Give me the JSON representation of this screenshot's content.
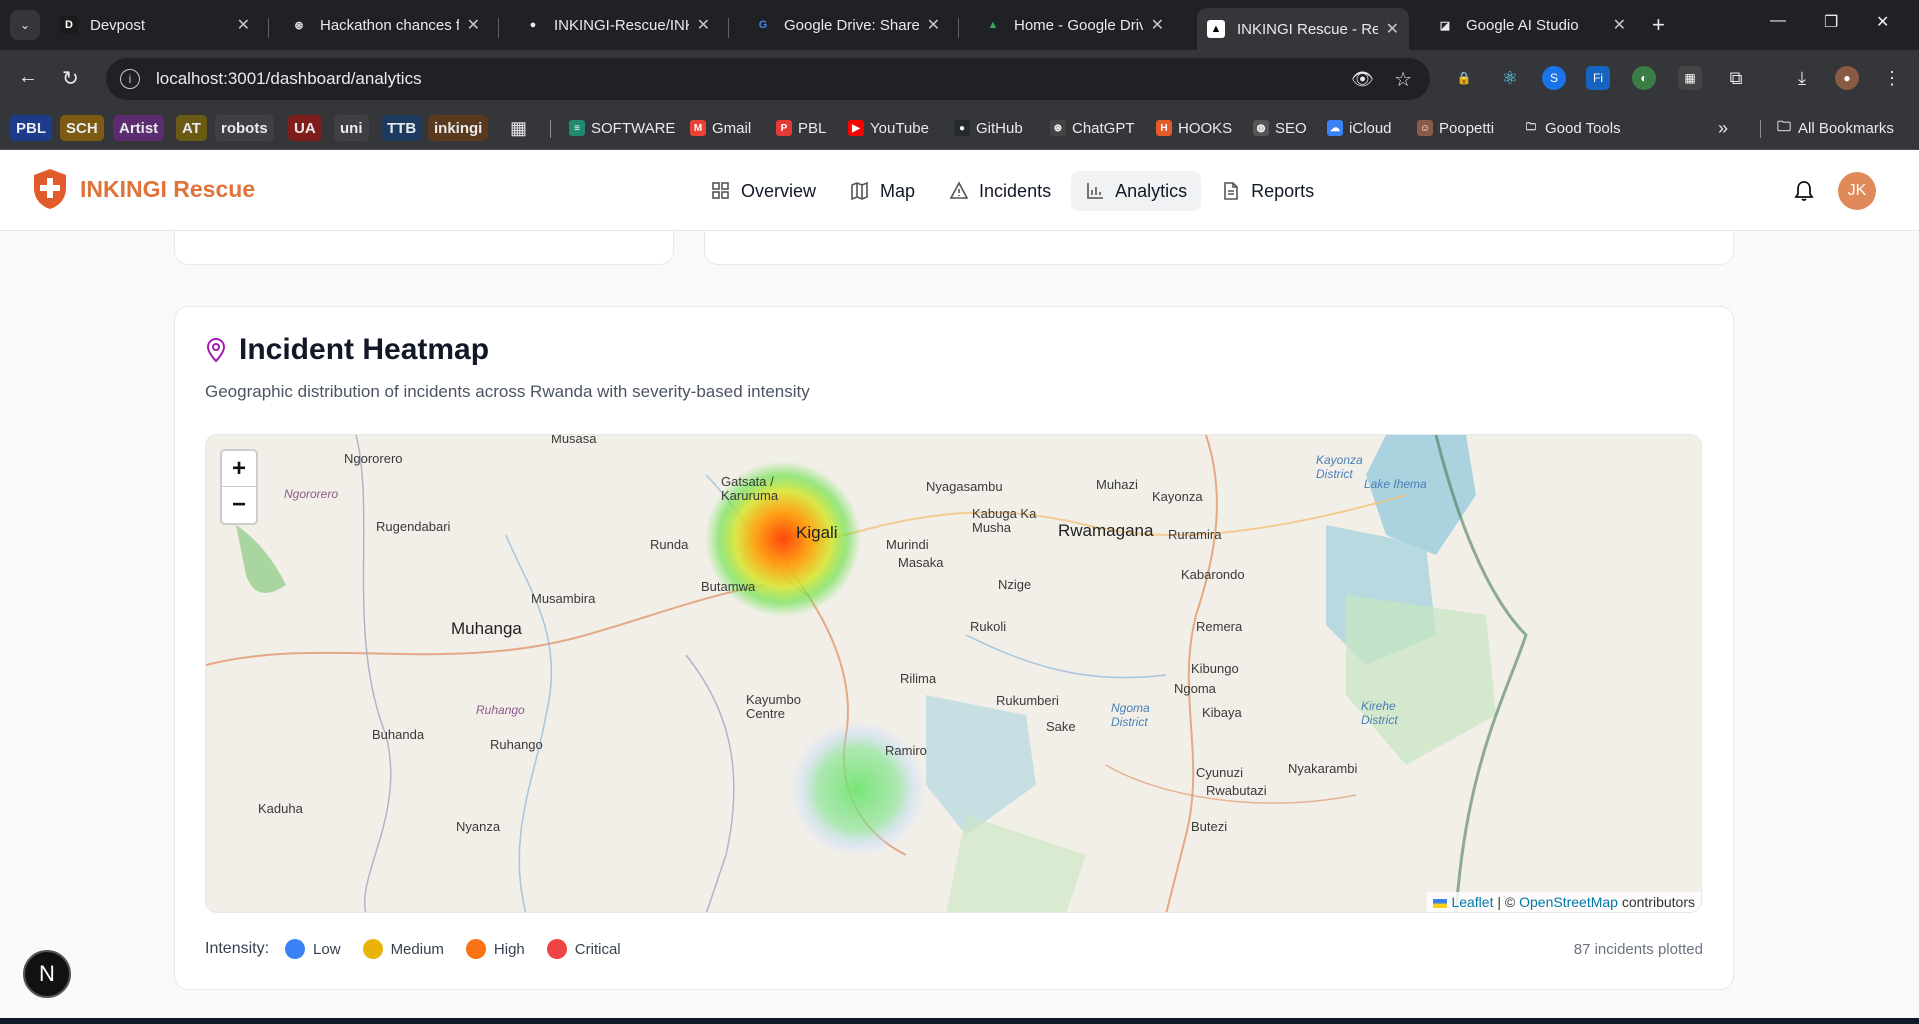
{
  "browser": {
    "tabs": [
      {
        "title": "Devpost",
        "icon": "devpost-icon"
      },
      {
        "title": "Hackathon chances fo",
        "icon": "chatgpt-icon"
      },
      {
        "title": "INKINGI-Rescue/INKI",
        "icon": "github-icon"
      },
      {
        "title": "Google Drive: Share l",
        "icon": "google-icon"
      },
      {
        "title": "Home - Google Drive",
        "icon": "google-drive-icon"
      },
      {
        "title": "INKINGI Rescue - Res",
        "icon": "vercel-icon",
        "active": true
      },
      {
        "title": "Google AI Studio",
        "icon": "ai-studio-icon"
      }
    ],
    "url": "localhost:3001/dashboard/analytics",
    "bookmarks_chips": [
      {
        "label": "PBL",
        "color": "#1e3a8a"
      },
      {
        "label": "SCH",
        "color": "#7c5a12"
      },
      {
        "label": "Artist",
        "color": "#5b2c6f"
      },
      {
        "label": "AT",
        "color": "#6b5a14"
      },
      {
        "label": "robots",
        "color": "#3f3f46"
      },
      {
        "label": "UA",
        "color": "#7f1d1d"
      },
      {
        "label": "uni",
        "color": "#3f3f46"
      },
      {
        "label": "TTB",
        "color": "#1e3a5f"
      },
      {
        "label": "inkingi",
        "color": "#5a3a1e"
      }
    ],
    "bookmarks": [
      {
        "label": "SOFTWARE",
        "icon": "software-icon"
      },
      {
        "label": "Gmail",
        "icon": "gmail-icon"
      },
      {
        "label": "PBL",
        "icon": "pbl-icon"
      },
      {
        "label": "YouTube",
        "icon": "youtube-icon"
      },
      {
        "label": "GitHub",
        "icon": "github-icon"
      },
      {
        "label": "ChatGPT",
        "icon": "chatgpt-icon"
      },
      {
        "label": "HOOKS",
        "icon": "hooks-icon"
      },
      {
        "label": "SEO",
        "icon": "globe-icon"
      },
      {
        "label": "iCloud",
        "icon": "icloud-icon"
      },
      {
        "label": "Poopetti",
        "icon": "poopetti-icon"
      },
      {
        "label": "Good Tools",
        "icon": "folder-icon"
      }
    ],
    "all_bookmarks": "All Bookmarks"
  },
  "app": {
    "brand": "INKINGI Rescue",
    "nav": [
      {
        "label": "Overview",
        "icon": "grid-icon"
      },
      {
        "label": "Map",
        "icon": "map-icon"
      },
      {
        "label": "Incidents",
        "icon": "warning-icon"
      },
      {
        "label": "Analytics",
        "icon": "bar-chart-icon",
        "active": true
      },
      {
        "label": "Reports",
        "icon": "document-icon"
      }
    ],
    "avatar_initials": "JK"
  },
  "heatmap": {
    "title": "Incident Heatmap",
    "subtitle": "Geographic distribution of incidents across Rwanda with severity-based intensity",
    "zoom_in": "+",
    "zoom_out": "−",
    "attribution": {
      "leaflet": "Leaflet",
      "sep": "| ©",
      "osm": "OpenStreetMap",
      "suffix": "contributors"
    },
    "legend_label": "Intensity:",
    "legend": [
      {
        "label": "Low",
        "color": "#3b82f6"
      },
      {
        "label": "Medium",
        "color": "#eab308"
      },
      {
        "label": "High",
        "color": "#f97316"
      },
      {
        "label": "Critical",
        "color": "#ef4444"
      }
    ],
    "plotted": "87 incidents plotted",
    "places": [
      "Musasa",
      "Ngororero",
      "Ngororero",
      "Rugendabari",
      "Gatsata / Karuruma",
      "Kigali",
      "Nyagasambu",
      "Muhazi",
      "Kayonza District",
      "Kayonza",
      "Lake Ihema",
      "Kabuga Ka Musha",
      "Rwamagana",
      "Ruramira",
      "Runda",
      "Murindi",
      "Masaka",
      "Kabarondo",
      "Butamwa",
      "Nzige",
      "Musambira",
      "Muhanga",
      "Rukoli",
      "Remera",
      "Rilima",
      "Kibungo",
      "Ngoma",
      "Kayumbo Centre",
      "Rukumberi",
      "Ngoma District",
      "Kibaya",
      "Kirehe District",
      "Ruhango",
      "Sake",
      "Buhanda",
      "Ruhango",
      "Ramiro",
      "Cyunuzi",
      "Nyakarambi",
      "Rwabutazi",
      "Kaduha",
      "Nyanza",
      "Butezi"
    ]
  },
  "next_badge": "N"
}
